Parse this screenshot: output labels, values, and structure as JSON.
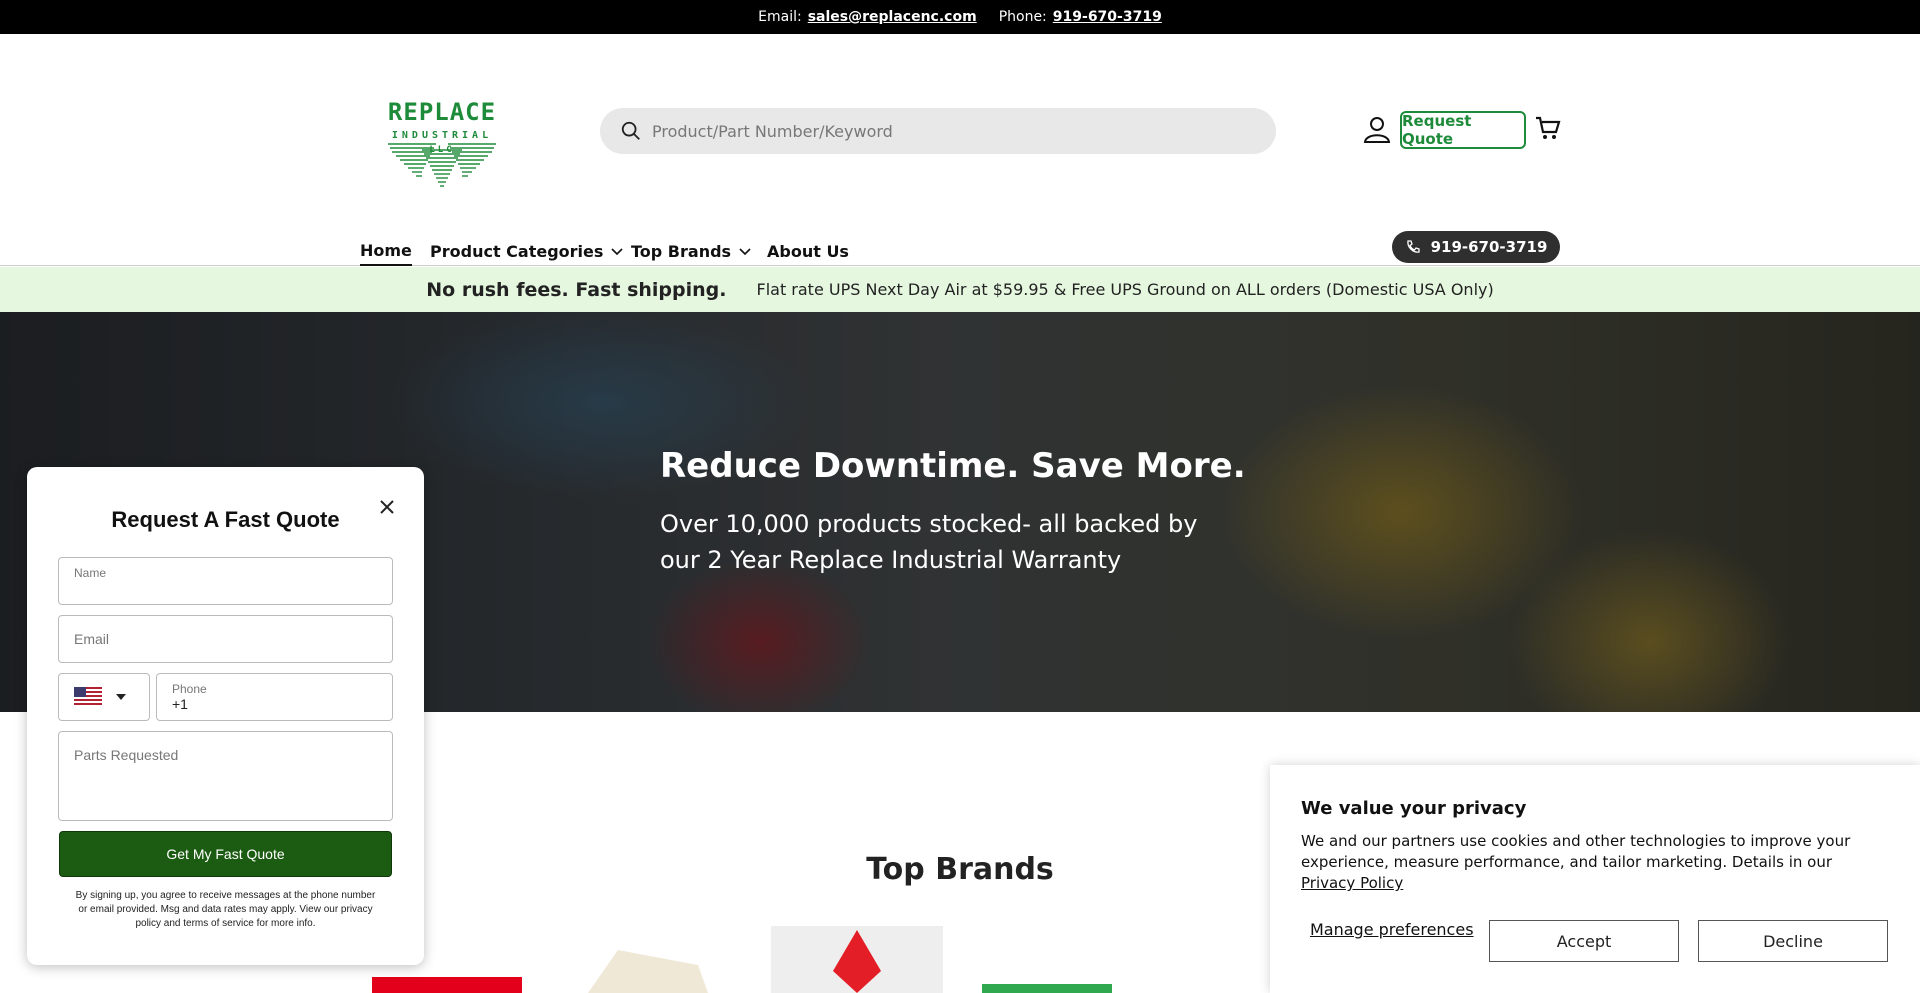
{
  "topbar": {
    "email_label": "Email:",
    "email": "sales@replacenc.com",
    "phone_label": "Phone:",
    "phone": "919-670-3719"
  },
  "logo": {
    "line1": "REPLACE",
    "line2": "INDUSTRIAL",
    "line3": "LLC",
    "color": "#1e8b3a"
  },
  "search": {
    "placeholder": "Product/Part Number/Keyword"
  },
  "header": {
    "request_quote": "Request Quote"
  },
  "nav": {
    "items": [
      {
        "label": "Home",
        "active": true
      },
      {
        "label": "Product Categories",
        "dropdown": true
      },
      {
        "label": "Top Brands",
        "dropdown": true
      },
      {
        "label": "About Us"
      }
    ],
    "phone": "919-670-3719"
  },
  "shipbar": {
    "headline": "No rush fees. Fast shipping.",
    "detail": "Flat rate UPS Next Day Air at $59.95 & Free UPS Ground on ALL orders (Domestic USA Only)",
    "bg_color": "#e6f7e0"
  },
  "hero": {
    "title": "Reduce Downtime. Save More.",
    "subtitle": "Over 10,000 products stocked- all backed by our 2 Year Replace Industrial Warranty"
  },
  "brands": {
    "title": "Top Brands"
  },
  "quote_form": {
    "title": "Request A Fast Quote",
    "name_label": "Name",
    "email_placeholder": "Email",
    "phone_label": "Phone",
    "phone_value": "+1",
    "parts_placeholder": "Parts Requested",
    "submit": "Get My Fast Quote",
    "legal": "By signing up, you agree to receive messages at the phone number or email provided. Msg and data rates may apply. View our privacy policy and terms of service for more info.",
    "submit_color": "#1c5c12"
  },
  "cookie": {
    "title": "We value your privacy",
    "text": "We and our partners use cookies and other technologies to improve your experience, measure performance, and tailor marketing. Details in our",
    "link": "Privacy Policy",
    "manage": "Manage preferences",
    "accept": "Accept",
    "decline": "Decline"
  }
}
